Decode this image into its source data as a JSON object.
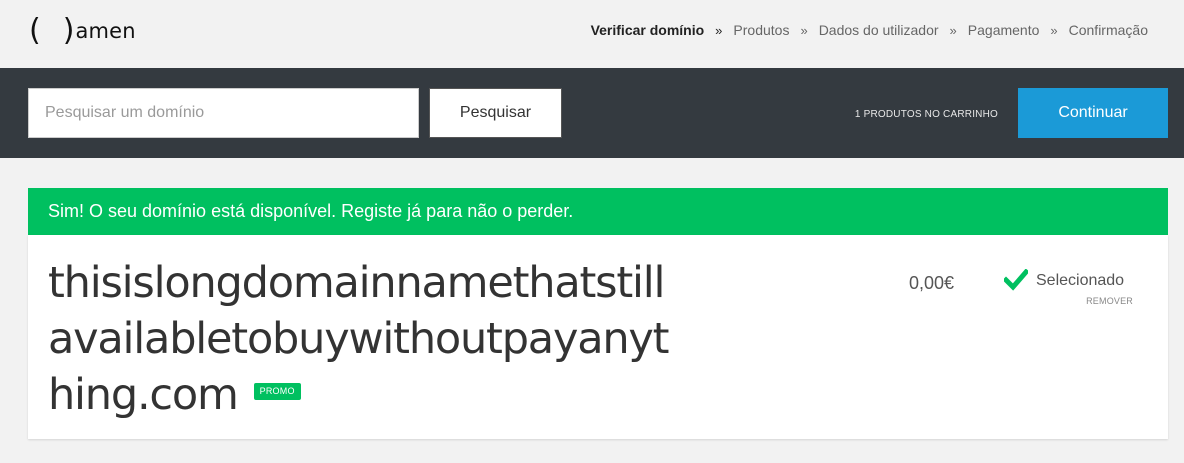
{
  "header": {
    "logo": {
      "left_paren": "(",
      "right_paren": ")",
      "text": "amen"
    },
    "steps": [
      {
        "label": "Verificar domínio",
        "active": true
      },
      {
        "label": "Produtos",
        "active": false
      },
      {
        "label": "Dados do utilizador",
        "active": false
      },
      {
        "label": "Pagamento",
        "active": false
      },
      {
        "label": "Confirmação",
        "active": false
      }
    ],
    "separator": "»"
  },
  "searchbar": {
    "input_value": "",
    "input_placeholder": "Pesquisar um domínio",
    "search_label": "Pesquisar",
    "cart_count": "1 PRODUTOS NO CARRINHO",
    "continue_label": "Continuar"
  },
  "result": {
    "banner": "Sim! O seu domínio está disponível. Registe já para não o perder.",
    "domain": "thisislongdomainnamethatstillavailabletobuywithoutpayanything.com",
    "promo_badge": "PROMO",
    "price": "0,00€",
    "status": "Selecionado",
    "remove_label": "REMOVER"
  },
  "colors": {
    "accent_green": "#00c060",
    "accent_blue": "#1b9ad7",
    "dark_bar": "#343a40",
    "background": "#f2f2f2"
  },
  "icons": {
    "status": "checkmark-icon"
  }
}
